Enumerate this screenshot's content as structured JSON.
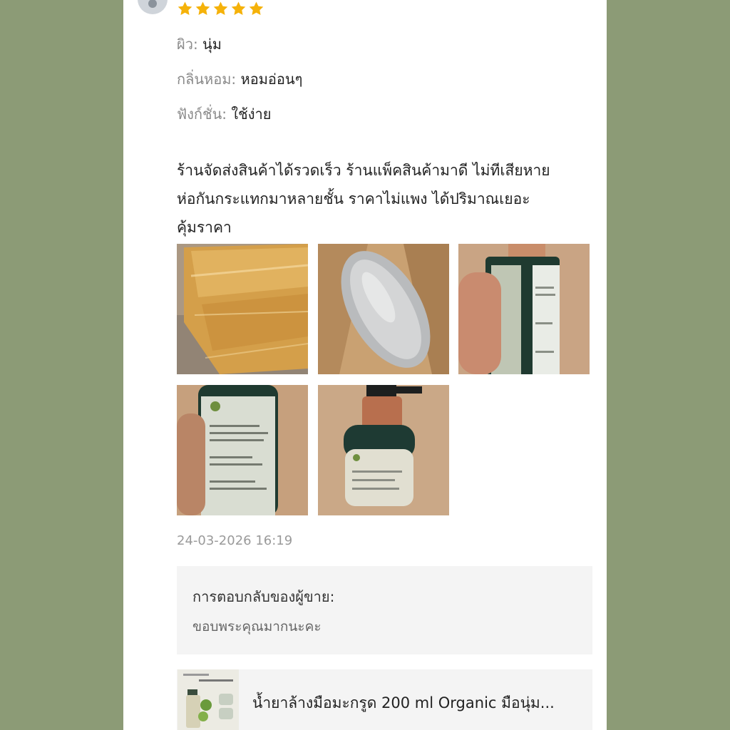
{
  "review": {
    "rating": 5,
    "rating_max": 5,
    "attributes": [
      {
        "label": "ผิว:",
        "value": "นุ่ม"
      },
      {
        "label": "กลิ่นหอม:",
        "value": "หอมอ่อนๆ"
      },
      {
        "label": "ฟังก์ชั่น:",
        "value": "ใช้ง่าย"
      }
    ],
    "comment_lines": [
      "ร้านจัดส่งสินค้าได้รวดเร็ว ร้านแพ็คสินค้ามาดี ไม่ทีเสียหาย",
      "ห่อกันกระแทกมาหลายชั้น ราคาไม่แพง ได้ปริมาณเยอะ",
      "คุ้มราคา"
    ],
    "timestamp": "24-03-2026 16:19"
  },
  "seller_reply": {
    "title": "การตอบกลับของผู้ขาย:",
    "text": "ขอบพระคุณมากนะคะ"
  },
  "product": {
    "name": "น้ำยาล้างมือมะกรูด 200 ml Organic มือนุ่ม..."
  },
  "colors": {
    "background": "#8c9b76",
    "star": "#f5b20a"
  }
}
